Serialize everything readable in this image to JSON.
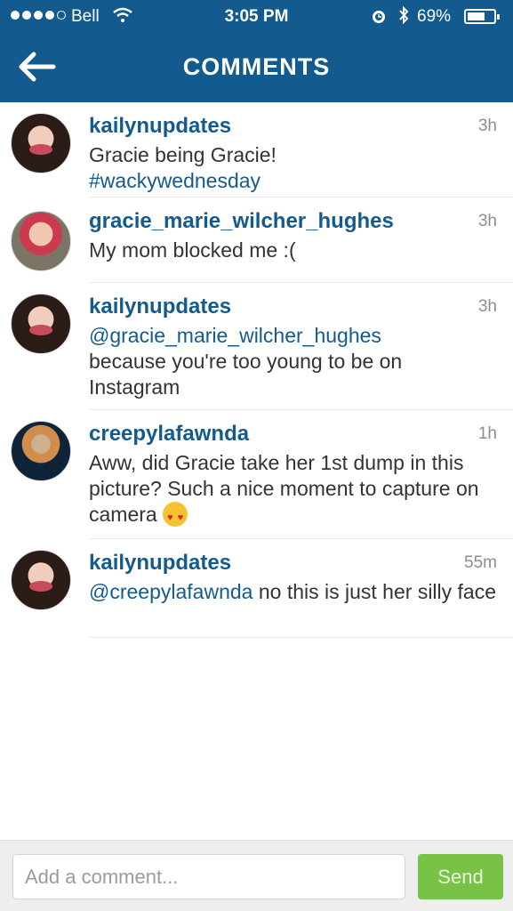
{
  "status_bar": {
    "carrier": "Bell",
    "time": "3:05 PM",
    "battery_percent": "69%",
    "battery_level": 0.69,
    "icons": [
      "signal-dots-icon",
      "wifi-icon",
      "alarm-icon",
      "bluetooth-icon",
      "battery-icon"
    ]
  },
  "header": {
    "title": "COMMENTS",
    "back_icon": "arrow-left-icon",
    "background_color": "#135b8f"
  },
  "comments": [
    {
      "username": "kailynupdates",
      "time": "3h",
      "text": "Gracie being Gracie!",
      "hashtag": "#wackywednesday"
    },
    {
      "username": "gracie_marie_wilcher_hughes",
      "time": "3h",
      "text": "My mom blocked me :("
    },
    {
      "username": "kailynupdates",
      "time": "3h",
      "mention": "@gracie_marie_wilcher_hughes",
      "text": "because you're too young to be on Instagram"
    },
    {
      "username": "creepylafawnda",
      "time": "1h",
      "text": "Aww, did Gracie take her 1st dump in this picture?  Such a nice moment to capture on camera",
      "emoji": "heart-eyes-emoji"
    },
    {
      "username": "kailynupdates",
      "time": "55m",
      "mention": "@creepylafawnda",
      "text": "no this is just her silly face"
    }
  ],
  "input": {
    "placeholder": "Add a comment...",
    "value": "",
    "send_label": "Send",
    "send_color": "#78c346"
  },
  "colors": {
    "username": "#135b8f",
    "timestamp": "#8d8d8d",
    "body_text": "#333333"
  }
}
